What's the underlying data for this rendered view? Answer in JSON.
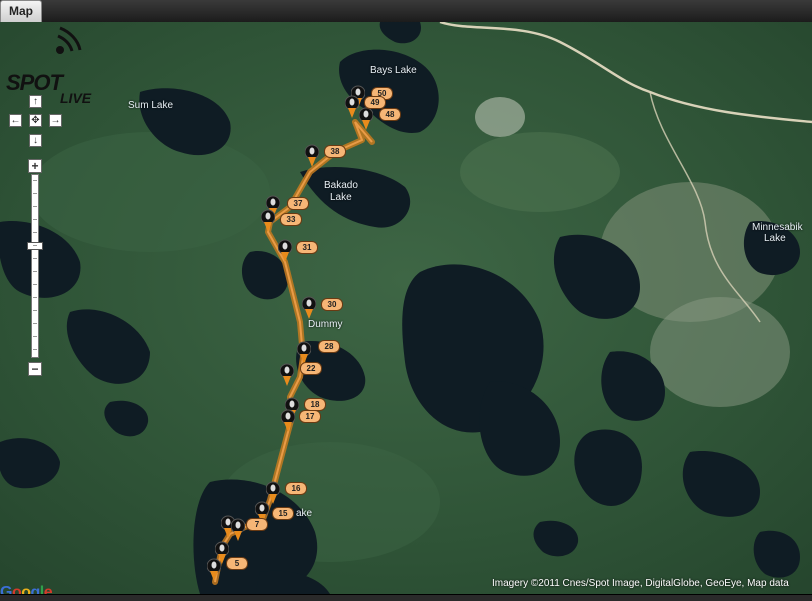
{
  "tabs": {
    "map_label": "Map"
  },
  "logo": {
    "spot": "SPOT",
    "live": "LIVE"
  },
  "nav": {
    "up": "↑",
    "left": "←",
    "center": "✥",
    "right": "→",
    "down": "↓"
  },
  "zoom": {
    "in": "+",
    "out": "−",
    "level": 0.62
  },
  "lakes": {
    "bays": "Bays Lake",
    "sum": "Sum Lake",
    "bakado_1": "Bakado",
    "bakado_2": "Lake",
    "minnesabik_1": "Minnesabik",
    "minnesabik_2": "Lake",
    "dummy": "Dummy",
    "ake": "ake"
  },
  "track_points": {
    "p50": "50",
    "p49": "49",
    "p48": "48",
    "p38": "38",
    "p37": "37",
    "p33": "33",
    "p31": "31",
    "p30": "30",
    "p28": "28",
    "p22": "22",
    "p18": "18",
    "p17": "17",
    "p16": "16",
    "p15": "15",
    "p7": "7",
    "p5": "5"
  },
  "colors": {
    "track": "#c67a1e",
    "marker": "#e88b1c",
    "badge": "#f6b676"
  },
  "google": {
    "G": "G",
    "o1": "o",
    "o2": "o",
    "g": "g",
    "l": "l",
    "e": "e"
  },
  "attribution": "Imagery ©2011 Cnes/Spot Image, DigitalGlobe, GeoEye, Map data"
}
